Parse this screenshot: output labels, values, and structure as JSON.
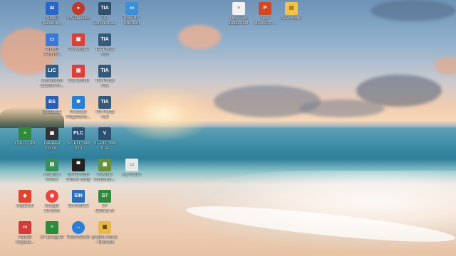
{
  "desktop": {
    "icons": [
      {
        "id": "autoid-network",
        "label1": "AutoID",
        "label2": "Network...",
        "glyph": "AI",
        "color": "#2a66c8"
      },
      {
        "id": "vw-develop",
        "label1": "VW Develop",
        "label2": "",
        "glyph": "●",
        "color": "#c0392b"
      },
      {
        "id": "tia-administra",
        "label1": "TIA",
        "label2": "Administra...",
        "glyph": "TIA",
        "color": "#2f4f6f"
      },
      {
        "id": "this-pc-shortcut",
        "label1": "This PC -",
        "label2": "Shortcut",
        "glyph": "▭",
        "color": "#3a8fd8"
      },
      {
        "id": "new-text-document",
        "label1": "New Text",
        "label2": "Document",
        "glyph": "≡",
        "color": "#f2f2f2"
      },
      {
        "id": "new-microsoft",
        "label1": "New",
        "label2": "Microsoft ...",
        "glyph": "P",
        "color": "#d24726"
      },
      {
        "id": "new-folder",
        "label1": "New folder",
        "label2": "",
        "glyph": "▤",
        "color": "#f0c24b"
      },
      {
        "id": "autoid-terminal",
        "label1": "AutoID",
        "label2": "Terminal",
        "glyph": "▭",
        "color": "#3c78d8"
      },
      {
        "id": "vw-worka-1",
        "label1": "VW WorkA",
        "label2": "",
        "glyph": "▦",
        "color": "#d9413a"
      },
      {
        "id": "tia-portal-v13",
        "label1": "TIA Portal",
        "label2": "V13",
        "glyph": "TIA",
        "color": "#355a7a"
      },
      {
        "id": "automation-license",
        "label1": "Automation",
        "label2": "License M...",
        "glyph": "LIC",
        "color": "#2d5f8a"
      },
      {
        "id": "vw-worka-2",
        "label1": "VW WorkB",
        "label2": "",
        "glyph": "▦",
        "color": "#d9413a"
      },
      {
        "id": "tia-portal-v14",
        "label1": "TIA Portal",
        "label2": "V14",
        "glyph": "TIA",
        "color": "#355a7a"
      },
      {
        "id": "bootstrap",
        "label1": "Bootstrap",
        "label2": "",
        "glyph": "BS",
        "color": "#2b5fb3"
      },
      {
        "id": "pinnacle-playmemories",
        "label1": "Pinnacle",
        "label2": "PlayMemo...",
        "glyph": "✽",
        "color": "#2a7fd4"
      },
      {
        "id": "tia-portal-v15",
        "label1": "TIA Portal",
        "label2": "V15",
        "glyph": "TIA",
        "color": "#355a7a"
      },
      {
        "id": "ovizcom",
        "label1": "OVIZCOM",
        "label2": "",
        "glyph": "≡",
        "color": "#2f8a3c"
      },
      {
        "id": "datamar",
        "label1": "DataMar",
        "label2": "v1.0 x...",
        "glyph": "▣",
        "color": "#333333"
      },
      {
        "id": "s7-plcsim-v13",
        "label1": "S7-PLCSIM",
        "label2": "V13",
        "glyph": "PLC",
        "color": "#2c4f72"
      },
      {
        "id": "s7-plcsim-v14",
        "label1": "S7-PLCSIM",
        "label2": "V14",
        "glyph": "V",
        "color": "#2c4f72"
      },
      {
        "id": "manual-viewer",
        "label1": "eManual",
        "label2": "Viewer",
        "glyph": "▤",
        "color": "#3b8f5a"
      },
      {
        "id": "sato-print",
        "label1": "SATO NSE",
        "label2": "Printer Utility",
        "glyph": "▀",
        "color": "#222222"
      },
      {
        "id": "vmware-workstation",
        "label1": "VMware",
        "label2": "Workstati...",
        "glyph": "▣",
        "color": "#6a8f3a"
      },
      {
        "id": "my-folder",
        "label1": "My Folder",
        "label2": "",
        "glyph": "▭",
        "color": "#e9e9e9"
      },
      {
        "id": "anydesk",
        "label1": "AnyDesk",
        "label2": "",
        "glyph": "◆",
        "color": "#e2452f"
      },
      {
        "id": "google-chrome",
        "label1": "Google",
        "label2": "Chrome",
        "glyph": "◉",
        "color": "#e8453c"
      },
      {
        "id": "sinamics",
        "label1": "SINAMICS",
        "label2": "",
        "glyph": "SIN",
        "color": "#2c6fb8"
      },
      {
        "id": "s7-simatic",
        "label1": "S7",
        "label2": "Simatic M",
        "glyph": "S7",
        "color": "#2f8a3c"
      },
      {
        "id": "autoid-keyboa",
        "label1": "AutoID",
        "label2": "Keyboa...",
        "glyph": "▭",
        "color": "#d63a3a"
      },
      {
        "id": "s7-designer",
        "label1": "S7 Designer",
        "label2": "",
        "glyph": "≡",
        "color": "#2f8a3c"
      },
      {
        "id": "teamviewer",
        "label1": "TeamViewer",
        "label2": "",
        "glyph": "↔",
        "color": "#2b7fd8"
      },
      {
        "id": "project-works",
        "label1": "project works",
        "label2": "- Shortcut",
        "glyph": "▦",
        "color": "#e9b84b"
      }
    ]
  }
}
